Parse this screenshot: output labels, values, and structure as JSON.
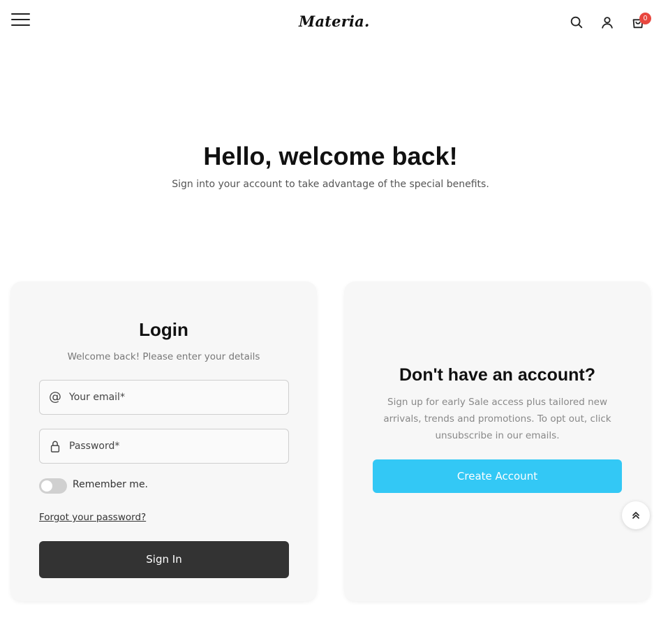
{
  "header": {
    "logo": "Materia.",
    "cart_count": "0",
    "icons": [
      "menu-icon",
      "search-icon",
      "user-icon",
      "cart-icon"
    ]
  },
  "hero": {
    "title": "Hello, welcome back!",
    "subtitle": "Sign into your account to take advantage of the special benefits."
  },
  "login": {
    "title": "Login",
    "subtitle": "Welcome back! Please enter your details",
    "email_placeholder": "Your email*",
    "password_placeholder": "Password*",
    "remember_label": "Remember me.",
    "remember_checked": false,
    "forgot_label": "Forgot your password?",
    "signin_label": "Sign In"
  },
  "register": {
    "title": "Don't have an account?",
    "description": "Sign up for early Sale access plus tailored new arrivals, trends and promotions. To opt out, click unsubscribe in our emails.",
    "create_label": "Create Account"
  },
  "colors": {
    "accent": "#33c8f5",
    "dark_button": "#333333",
    "badge": "#e8473f",
    "card_bg": "#f7f7f7"
  }
}
